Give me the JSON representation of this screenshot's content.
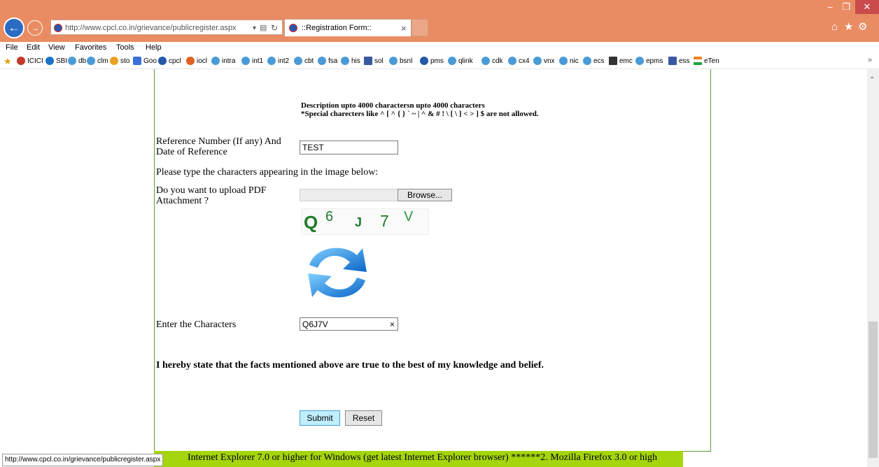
{
  "browser": {
    "address_url": "http://www.cpcl.co.in/grievance/publicregister.aspx",
    "tab_title": "::Registration Form::",
    "tab_close": "×",
    "menu": [
      "File",
      "Edit",
      "View",
      "Favorites",
      "Tools",
      "Help"
    ],
    "favorites": [
      "ICICI",
      "SBI",
      "db",
      "clm",
      "sto",
      "Goo",
      "cpcl",
      "iocl",
      "intra",
      "int1",
      "int2",
      "cbt",
      "fsa",
      "his",
      "sol",
      "bsnl",
      "pms",
      "qlink",
      "cdk",
      "cx4",
      "vnx",
      "nic",
      "ecs",
      "emc",
      "epms",
      "ess",
      "eTen"
    ],
    "status_url": "http://www.cpcl.co.in/grievance/publicregister.aspx",
    "colors": {
      "titlebar": "#e98c63",
      "close_button": "#c94b4b",
      "notice_bar": "#a5d50c"
    }
  },
  "form": {
    "description_note": "Description upto 4000 charactersn upto 4000 characters",
    "special_chars_note": "*Special charecters like ^ [ ^ { } ` ~ | ^ & # ! \\ [ \\ ] < > ] $ are not allowed.",
    "reference_label": "Reference Number (If any) And Date of Reference",
    "reference_value": "TEST",
    "captcha_prompt": "Please type the characters appearing in the image below:",
    "upload_label": "Do you want to upload PDF Attachment ?",
    "browse_label": "Browse...",
    "captcha_text": "Q6J7V",
    "enter_chars_label": "Enter the Characters",
    "enter_chars_value": "Q6J7V",
    "clear_glyph": "×",
    "declaration": "I hereby state that the facts mentioned above are true to the best of my knowledge and belief.",
    "submit_label": "Submit",
    "reset_label": "Reset"
  },
  "notice_text": "Internet Explorer 7.0 or higher for Windows (get latest Internet Explorer browser) ******2. Mozilla Firefox 3.0 or high"
}
